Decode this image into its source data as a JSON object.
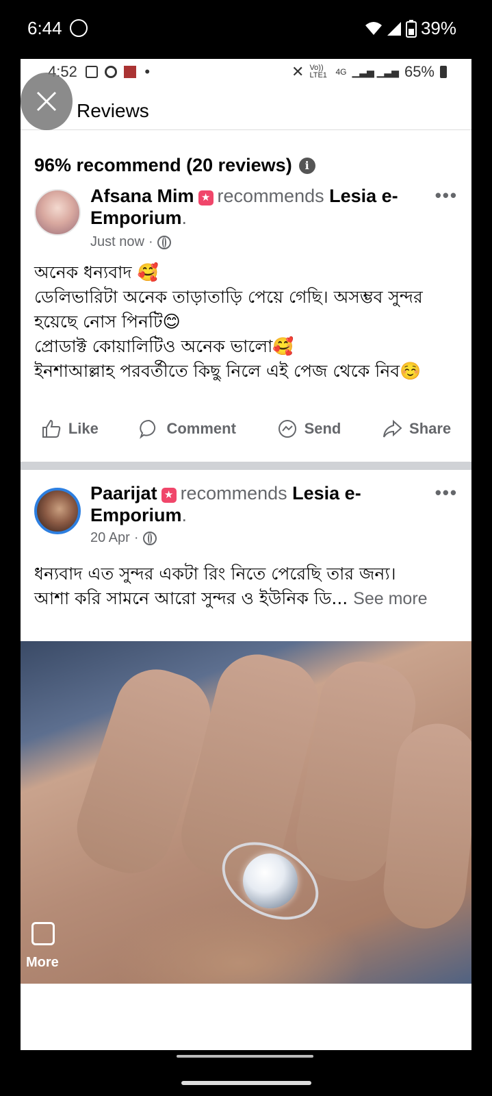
{
  "outer_status": {
    "time": "6:44",
    "battery": "39%"
  },
  "inner_status": {
    "time": "4:52",
    "net": "Vo)) LTE1",
    "gen": "4G",
    "battery": "65%"
  },
  "header": {
    "title": "Reviews"
  },
  "summary": {
    "text": "96% recommend (20 reviews)"
  },
  "reviews": [
    {
      "name": "Afsana Mim",
      "recommends": "recommends",
      "page": "Lesia e-Emporium",
      "time": "Just now",
      "lines": [
        "অনেক ধন্যবাদ 🥰",
        "ডেলিভারিটা অনেক তাড়াতাড়ি পেয়ে গেছি। অসম্ভব সুন্দর",
        "হয়েছে নোস পিনটি😊",
        "প্রোডাক্ট কোয়ালিটিও অনেক ভালো🥰",
        "ইনশাআল্লাহ পরবর্তীতে কিছু নিলে এই পেজ থেকে নিব☺️"
      ]
    },
    {
      "name": "Paarijat",
      "recommends": "recommends",
      "page": "Lesia e-Emporium",
      "time": "20 Apr",
      "lines": [
        "ধন্যবাদ এত সুন্দর একটা রিং নিতে পেরেছি তার জন্য।",
        "আশা করি সামনে আরো সুন্দর ও ইউনিক ডি..."
      ],
      "see_more": "See more"
    }
  ],
  "actions": {
    "like": "Like",
    "comment": "Comment",
    "send": "Send",
    "share": "Share"
  },
  "photo": {
    "more_label": "More"
  }
}
